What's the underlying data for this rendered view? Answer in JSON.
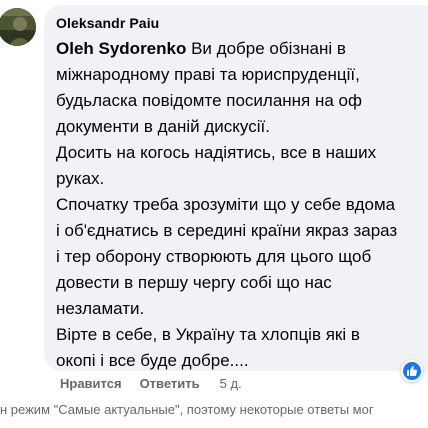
{
  "comment": {
    "author": "Oleksandr Paiu",
    "mention": "Oleh Sydorenko",
    "text_after_mention": " Ви добре обізнані в\nміжнародному праві та юриспруденції,\nбудьласка повідомте посилання на оф\nдокументи в даній дискусії.\nДосить на когось надіятись, все в наших\nруках.\nСпочатку треба зрозуміти що у себе вдома\nі об'єднатись в середині країни якраз зараз\nі тер оборону створюють для цього щоб\nдовести в першу чергу собі що нас\nнезламати.\nВірте в себе, в Україну та хлопців які в\nокопі і все буде добре....",
    "reaction": "like",
    "reaction_icon": "thumbs-up-icon"
  },
  "actions": {
    "like_label": "Нравится",
    "reply_label": "Ответить",
    "timestamp": "5 д."
  },
  "notice": "н режим \"Самые актуальные\", поэтому некоторые ответы мог",
  "colors": {
    "bubble_bg": "#f0f2f5",
    "text": "#050505",
    "secondary_text": "#65676b",
    "reaction_blue": "#1877f2"
  }
}
